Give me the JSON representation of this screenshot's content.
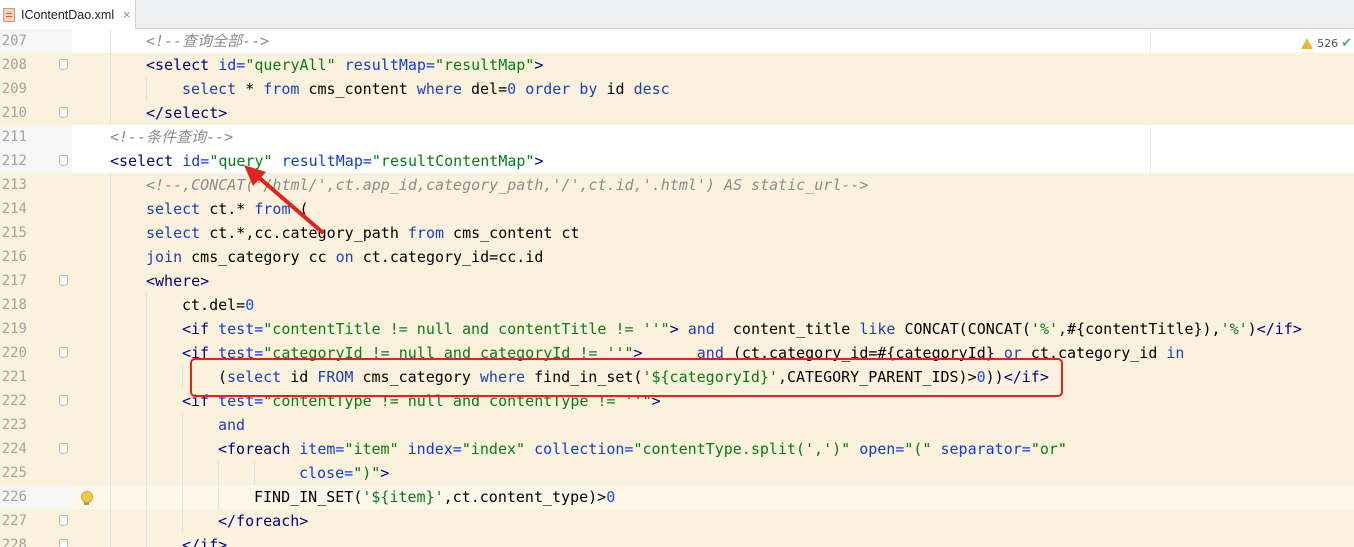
{
  "tab": {
    "file_name": "IContentDao.xml",
    "close_glyph": "×",
    "icon": "xml-file-icon"
  },
  "inspections": {
    "warning_count": "526",
    "icon": "warning-icon",
    "check_glyph": "✔"
  },
  "colors": {
    "annotation": "#e0241b",
    "highlight": "#fbf2de"
  },
  "lines": [
    {
      "num": "207",
      "indent": 2,
      "hl": false,
      "fold": false,
      "tokens": [
        [
          "cmt",
          "<!--查询全部-->"
        ]
      ]
    },
    {
      "num": "208",
      "indent": 2,
      "hl": true,
      "fold": true,
      "tokens": [
        [
          "tag",
          "<select "
        ],
        [
          "attr",
          "id="
        ],
        [
          "val",
          "\"queryAll\""
        ],
        [
          "attr",
          " resultMap="
        ],
        [
          "val",
          "\"resultMap\""
        ],
        [
          "tag",
          ">"
        ]
      ]
    },
    {
      "num": "209",
      "indent": 3,
      "hl": true,
      "fold": false,
      "tokens": [
        [
          "kw",
          "select"
        ],
        [
          "txt",
          " * "
        ],
        [
          "kw",
          "from"
        ],
        [
          "txt",
          " cms_content "
        ],
        [
          "kw",
          "where"
        ],
        [
          "txt",
          " del="
        ],
        [
          "num",
          "0"
        ],
        [
          "txt",
          " "
        ],
        [
          "kw",
          "order by"
        ],
        [
          "txt",
          " id "
        ],
        [
          "kw",
          "desc"
        ]
      ]
    },
    {
      "num": "210",
      "indent": 2,
      "hl": true,
      "fold": true,
      "tokens": [
        [
          "tag",
          "</select>"
        ]
      ]
    },
    {
      "num": "211",
      "indent": 1,
      "hl": false,
      "fold": false,
      "tokens": [
        [
          "cmt",
          "<!--条件查询-->"
        ]
      ]
    },
    {
      "num": "212",
      "indent": 1,
      "hl": false,
      "fold": true,
      "tokens": [
        [
          "tag",
          "<select "
        ],
        [
          "attr",
          "id="
        ],
        [
          "val",
          "\"query\""
        ],
        [
          "attr",
          " resultMap="
        ],
        [
          "val",
          "\"resultContentMap\""
        ],
        [
          "tag",
          ">"
        ]
      ]
    },
    {
      "num": "213",
      "indent": 2,
      "hl": true,
      "fold": false,
      "tokens": [
        [
          "cmt",
          "<!--,CONCAT('/html/',ct.app_id,category_path,'/',ct.id,'.html') AS static_url-->"
        ]
      ]
    },
    {
      "num": "214",
      "indent": 2,
      "hl": true,
      "fold": false,
      "tokens": [
        [
          "kw",
          "select"
        ],
        [
          "txt",
          " ct.* "
        ],
        [
          "kw",
          "from"
        ],
        [
          "txt",
          " ("
        ]
      ]
    },
    {
      "num": "215",
      "indent": 2,
      "hl": true,
      "fold": false,
      "tokens": [
        [
          "kw",
          "select"
        ],
        [
          "txt",
          " ct.*,cc.category_path "
        ],
        [
          "kw",
          "from"
        ],
        [
          "txt",
          " cms_content ct"
        ]
      ]
    },
    {
      "num": "216",
      "indent": 2,
      "hl": true,
      "fold": false,
      "tokens": [
        [
          "kw",
          "join"
        ],
        [
          "txt",
          " cms_category cc "
        ],
        [
          "kw",
          "on"
        ],
        [
          "txt",
          " ct.category_id=cc.id"
        ]
      ]
    },
    {
      "num": "217",
      "indent": 2,
      "hl": true,
      "fold": true,
      "tokens": [
        [
          "tag",
          "<where>"
        ]
      ]
    },
    {
      "num": "218",
      "indent": 3,
      "hl": true,
      "fold": false,
      "tokens": [
        [
          "txt",
          "ct.del="
        ],
        [
          "num",
          "0"
        ]
      ]
    },
    {
      "num": "219",
      "indent": 3,
      "hl": true,
      "fold": false,
      "tokens": [
        [
          "tag",
          "<if "
        ],
        [
          "attr",
          "test="
        ],
        [
          "val",
          "\"contentTitle != null and contentTitle != ''\""
        ],
        [
          "tag",
          ">"
        ],
        [
          "txt",
          " "
        ],
        [
          "kw",
          "and"
        ],
        [
          "txt",
          "  content_title "
        ],
        [
          "kw",
          "like"
        ],
        [
          "txt",
          " CONCAT(CONCAT("
        ],
        [
          "str",
          "'%'"
        ],
        [
          "txt",
          ",#{contentTitle}),"
        ],
        [
          "str",
          "'%'"
        ],
        [
          "txt",
          ")"
        ],
        [
          "tag",
          "</if>"
        ]
      ]
    },
    {
      "num": "220",
      "indent": 3,
      "hl": true,
      "fold": true,
      "tokens": [
        [
          "tag",
          "<if "
        ],
        [
          "attr",
          "test="
        ],
        [
          "val",
          "\"categoryId != null and categoryId != ''\""
        ],
        [
          "tag",
          ">"
        ],
        [
          "txt",
          "      "
        ],
        [
          "kw",
          "and"
        ],
        [
          "txt",
          " (ct.category_id=#{categoryId} "
        ],
        [
          "kw",
          "or"
        ],
        [
          "txt",
          " ct.category_id "
        ],
        [
          "kw",
          "in"
        ]
      ]
    },
    {
      "num": "221",
      "indent": 4,
      "hl": true,
      "fold": false,
      "tokens": [
        [
          "txt",
          "("
        ],
        [
          "kw",
          "select"
        ],
        [
          "txt",
          " id "
        ],
        [
          "kw",
          "FROM"
        ],
        [
          "txt",
          " cms_category "
        ],
        [
          "kw",
          "where"
        ],
        [
          "txt",
          " find_in_set("
        ],
        [
          "str",
          "'${categoryId}'"
        ],
        [
          "txt",
          ",CATEGORY_PARENT_IDS)>"
        ],
        [
          "num",
          "0"
        ],
        [
          "txt",
          "))"
        ],
        [
          "tag",
          "</if>"
        ]
      ]
    },
    {
      "num": "222",
      "indent": 3,
      "hl": true,
      "fold": true,
      "tokens": [
        [
          "tag",
          "<if "
        ],
        [
          "attr",
          "test="
        ],
        [
          "val",
          "\"contentType != null and contentType != ''\""
        ],
        [
          "tag",
          ">"
        ]
      ]
    },
    {
      "num": "223",
      "indent": 4,
      "hl": true,
      "fold": false,
      "tokens": [
        [
          "kw",
          "and"
        ]
      ]
    },
    {
      "num": "224",
      "indent": 4,
      "hl": true,
      "fold": true,
      "tokens": [
        [
          "tag",
          "<foreach "
        ],
        [
          "attr",
          "item="
        ],
        [
          "val",
          "\"item\""
        ],
        [
          "attr",
          " index="
        ],
        [
          "val",
          "\"index\""
        ],
        [
          "attr",
          " collection="
        ],
        [
          "val",
          "\"contentType.split(',')\""
        ],
        [
          "attr",
          " open="
        ],
        [
          "val",
          "\"(\""
        ],
        [
          "attr",
          " separator="
        ],
        [
          "val",
          "\"or\""
        ]
      ]
    },
    {
      "num": "225",
      "indent": 6.25,
      "hl": true,
      "fold": false,
      "tokens": [
        [
          "attr",
          "close="
        ],
        [
          "val",
          "\")\""
        ],
        [
          "tag",
          ">"
        ]
      ]
    },
    {
      "num": "226",
      "indent": 5,
      "hl": false,
      "cur": true,
      "fold": false,
      "bulb": true,
      "tokens": [
        [
          "txt",
          "FIND_IN_SET("
        ],
        [
          "str",
          "'${item}'"
        ],
        [
          "txt",
          ",ct.content_type)>"
        ],
        [
          "num",
          "0"
        ]
      ]
    },
    {
      "num": "227",
      "indent": 4,
      "hl": true,
      "fold": true,
      "tokens": [
        [
          "tag",
          "</foreach>"
        ]
      ]
    },
    {
      "num": "228",
      "indent": 3,
      "hl": true,
      "fold": true,
      "tokens": [
        [
          "tag",
          "</if>"
        ]
      ]
    }
  ]
}
